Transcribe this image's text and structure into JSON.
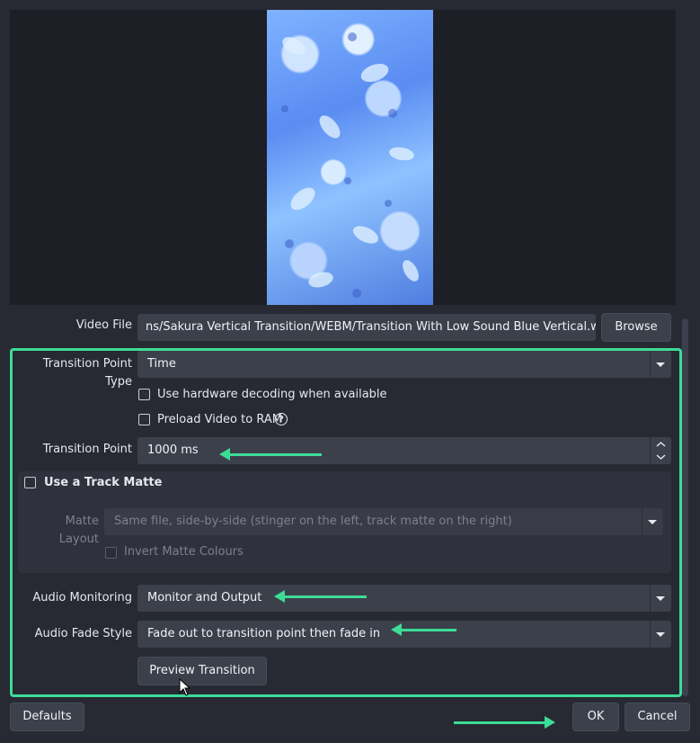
{
  "video_file": {
    "label": "Video File",
    "value": "ns/Sakura Vertical Transition/WEBM/Transition With Low Sound Blue Vertical.webm",
    "browse_label": "Browse"
  },
  "transition_point_type": {
    "label": "Transition Point Type",
    "value": "Time"
  },
  "hardware_decoding": {
    "label": "Use hardware decoding when available",
    "checked": false
  },
  "preload_video": {
    "label": "Preload Video to RAM",
    "checked": false,
    "help_icon": "question-circle-icon"
  },
  "transition_point": {
    "label": "Transition Point",
    "value": "1000 ms"
  },
  "track_matte": {
    "label": "Use a Track Matte",
    "checked": false,
    "matte_layout_label": "Matte Layout",
    "matte_layout_value": "Same file, side-by-side (stinger on the left, track matte on the right)",
    "invert_label": "Invert Matte Colours",
    "invert_checked": false
  },
  "audio_monitoring": {
    "label": "Audio Monitoring",
    "value": "Monitor and Output"
  },
  "audio_fade_style": {
    "label": "Audio Fade Style",
    "value": "Fade out to transition point then fade in"
  },
  "preview_button_label": "Preview Transition",
  "footer": {
    "defaults_label": "Defaults",
    "ok_label": "OK",
    "cancel_label": "Cancel"
  },
  "colors": {
    "highlight": "#3ddc97",
    "background": "#272a33",
    "field": "#3c404b"
  }
}
